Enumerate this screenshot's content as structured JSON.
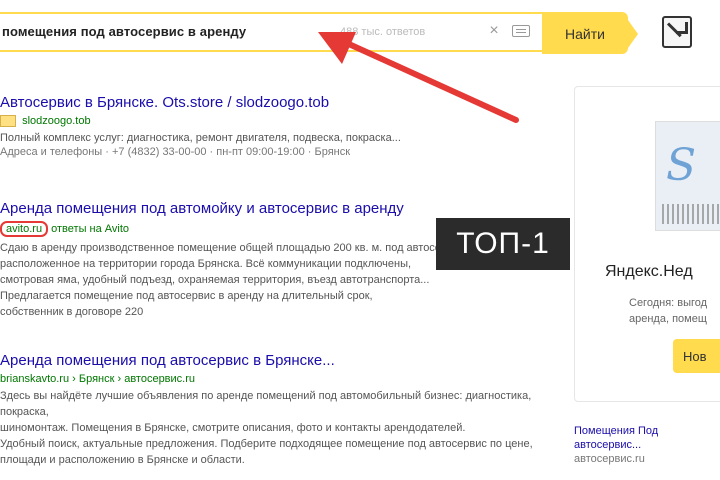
{
  "search": {
    "query": "помещения под автосервис в аренду",
    "hint": "488 тыс. ответов",
    "find_label": "Найти"
  },
  "annotation": {
    "top_badge": "ТОП-1"
  },
  "results": [
    {
      "title": "Автосервис в Брянске. Ots.store / slodzoogo.tob",
      "url": "slodzoogo.tob",
      "url_badge": "",
      "text": "Полный комплекс услуг: диагностика, ремонт двигателя, подвеска, покраска...",
      "meta": "Адреса и телефоны · +7 (4832) 33-00-00 · пн-пт 09:00-19:00 · Брянск"
    },
    {
      "title": "Аренда помещения под автомойку и автосервис в аренду",
      "url_framed": "avito.ru",
      "url": "ответы на Avito",
      "text_lines": [
        "Сдаю в аренду производственное помещение общей площадью 200 кв. м. под автосервис,",
        "расположенное на территории города Брянска. Всё коммуникации подключены,",
        "смотровая яма, удобный подъезд, охраняемая территория, въезд автотранспорта...",
        "Предлагается помещение под автосервис в аренду на длительный срок,",
        "собственник в договоре 220"
      ]
    },
    {
      "title": "Аренда помещения под автосервис в Брянске...",
      "url": "brianskavto.ru › Брянск › автосервис.ru",
      "text_lines": [
        "Здесь вы найдёте лучшие объявления по аренде помещений под автомобильный бизнес: диагностика, покраска,",
        "шиномонтаж. Помещения в Брянске, смотрите описания, фото и контакты арендодателей.",
        "Удобный поиск, актуальные предложения. Подберите подходящее помещение под автосервис по цене,",
        "площади и расположению в Брянске и области."
      ]
    }
  ],
  "side_card": {
    "title": "Яндекс.Нед",
    "desc_lines": [
      "Сегодня: выгод",
      "аренда, помещ"
    ],
    "button_label": "Нов"
  },
  "side_ad": {
    "text": "Помещения Под автосервис...",
    "meta": "автосервис.ru"
  }
}
